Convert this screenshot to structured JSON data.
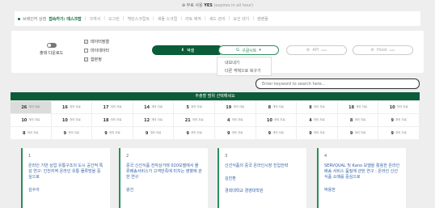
{
  "top_notice": {
    "label": "무료 사용",
    "value": "YES",
    "note": "(expires in all hour)"
  },
  "infobar": {
    "label": "브레인커 상점",
    "current": "접속카기: 데스크탑",
    "items": [
      "크게서",
      "오그런",
      "백린스크립트",
      "새들 스크립",
      "라토 제작",
      "새드 관리",
      "요인 대기",
      "랜랜들"
    ]
  },
  "options": {
    "toggle_label": "출데 다운로드",
    "checkboxes": [
      {
        "label": "데이터정렬",
        "checked": true
      },
      {
        "label": "마이데이터",
        "checked": false
      },
      {
        "label": "합본정",
        "checked": true
      }
    ]
  },
  "buttons": {
    "excel": "엑셀",
    "google": "구글시트",
    "api": "API",
    "api_sup": "beta",
    "hook": "Hook",
    "hook_sup": "beta"
  },
  "dropdown": {
    "items": [
      "내보내기",
      "다른 객체으로 복구기"
    ]
  },
  "search": {
    "placeholder": "Enter keyword to search here..."
  },
  "grid": {
    "header": "추출할 범위 선택해세요",
    "unit": "개의 자료",
    "cells": [
      "26",
      "16",
      "17",
      "14",
      "5",
      "19",
      "8",
      "8",
      "18",
      "10",
      "10",
      "10",
      "18",
      "12",
      "21",
      "4",
      "10",
      "4",
      "8",
      "9",
      "8",
      "9",
      "9",
      "9",
      "9",
      "9",
      "9",
      "9",
      "9",
      "9"
    ]
  },
  "cards": [
    {
      "num": "1",
      "title": "온라인 기반 상업 유통구조의 도시 공간적 특성 연구: 인천지역 온라인 유통 물류망을 중심으로",
      "author": "김수아"
    },
    {
      "num": "2",
      "title": "중국 신선식품 전자상거래 020모델에서 물류배송서비스가 고객만족에 미치는 영향에 관한 연구",
      "author": "왕건"
    },
    {
      "num": "3",
      "title": "신선식품의 중국 온라인시장 진입전략",
      "author": "김진환",
      "org": "경희대학교 경영대학원"
    },
    {
      "num": "4",
      "title": "SERVQUAL 및 Kano 모델을 활용한 온라인 배송 서비스 품질에 관한 연구 : 온라인 신선식품 소매를 중심으로",
      "author": "박용한"
    }
  ]
}
